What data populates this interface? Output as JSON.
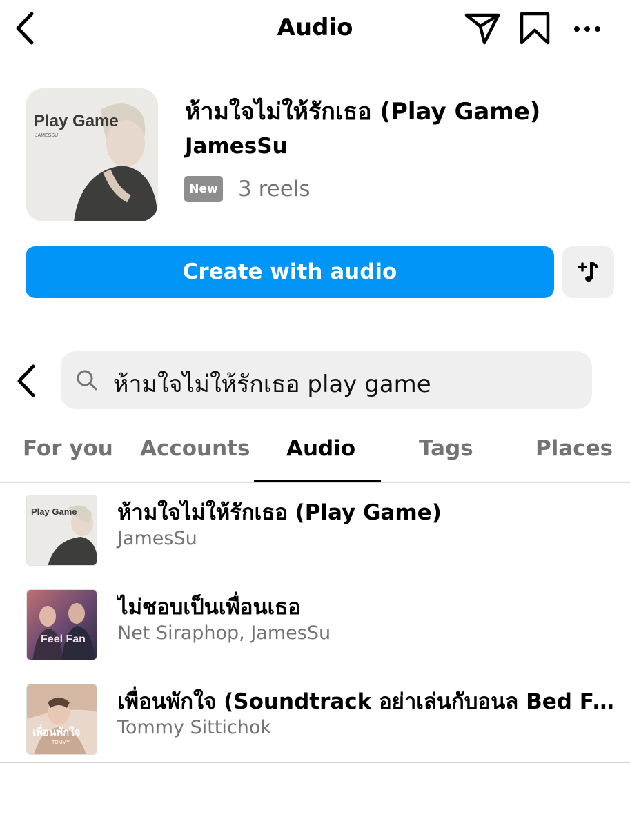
{
  "header": {
    "title": "Audio",
    "icons": [
      "back-icon",
      "send-icon",
      "bookmark-icon",
      "more-icon"
    ]
  },
  "audio": {
    "cover_text": "Play Game",
    "cover_subtext": "JAMESSU",
    "title": "ห้ามใจไม่ให้รักเธอ (Play Game)",
    "artist": "JamesSu",
    "badge": "New",
    "reels": "3 reels",
    "create_label": "Create with audio"
  },
  "search": {
    "value": "ห้ามใจไม่ให้รักเธอ play game"
  },
  "tabs": [
    {
      "label": "For you",
      "active": false
    },
    {
      "label": "Accounts",
      "active": false
    },
    {
      "label": "Audio",
      "active": true
    },
    {
      "label": "Tags",
      "active": false
    },
    {
      "label": "Places",
      "active": false
    }
  ],
  "results": [
    {
      "title": "ห้ามใจไม่ให้รักเธอ (Play Game)",
      "subtitle": "JamesSu",
      "cover_text": "Play Game"
    },
    {
      "title": "ไม่ชอบเป็นเพื่อนเธอ",
      "subtitle": "Net Siraphop, JamesSu",
      "cover_text": "Feel Fan"
    },
    {
      "title": "เพื่อนพักใจ (Soundtrack อย่าเล่นกับอนล Bed Fri...",
      "subtitle": "Tommy Sittichok",
      "cover_text": "เพื่อนพักใจ",
      "cover_subtext": "TOMMY"
    }
  ],
  "colors": {
    "accent": "#0095f6",
    "muted_text": "#737373",
    "field_bg": "#efefef",
    "badge_bg": "#8e8e8e"
  }
}
